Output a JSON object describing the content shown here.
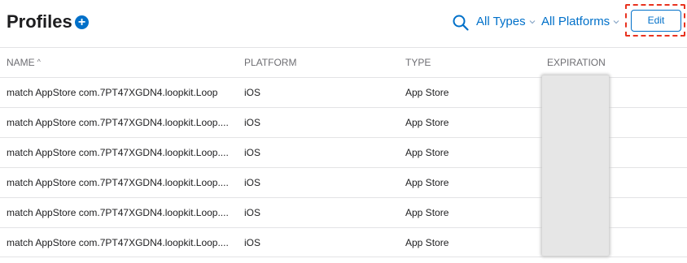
{
  "header": {
    "title": "Profiles",
    "add_icon": "plus-circle-icon",
    "search_icon": "search-icon",
    "filter_types": "All Types",
    "filter_platforms": "All Platforms",
    "edit_label": "Edit"
  },
  "colors": {
    "accent": "#0070c9",
    "highlight_border": "#e8321f",
    "divider": "#e3e3e5",
    "redaction": "#e6e6e6"
  },
  "table": {
    "columns": {
      "name": "NAME",
      "platform": "PLATFORM",
      "type": "TYPE",
      "expiration": "EXPIRATION"
    },
    "sort_indicator": "^",
    "rows": [
      {
        "name": "match AppStore com.7PT47XGDN4.loopkit.Loop",
        "platform": "iOS",
        "type": "App Store"
      },
      {
        "name": "match AppStore com.7PT47XGDN4.loopkit.Loop....",
        "platform": "iOS",
        "type": "App Store"
      },
      {
        "name": "match AppStore com.7PT47XGDN4.loopkit.Loop....",
        "platform": "iOS",
        "type": "App Store"
      },
      {
        "name": "match AppStore com.7PT47XGDN4.loopkit.Loop....",
        "platform": "iOS",
        "type": "App Store"
      },
      {
        "name": "match AppStore com.7PT47XGDN4.loopkit.Loop....",
        "platform": "iOS",
        "type": "App Store"
      },
      {
        "name": "match AppStore com.7PT47XGDN4.loopkit.Loop....",
        "platform": "iOS",
        "type": "App Store"
      }
    ]
  }
}
